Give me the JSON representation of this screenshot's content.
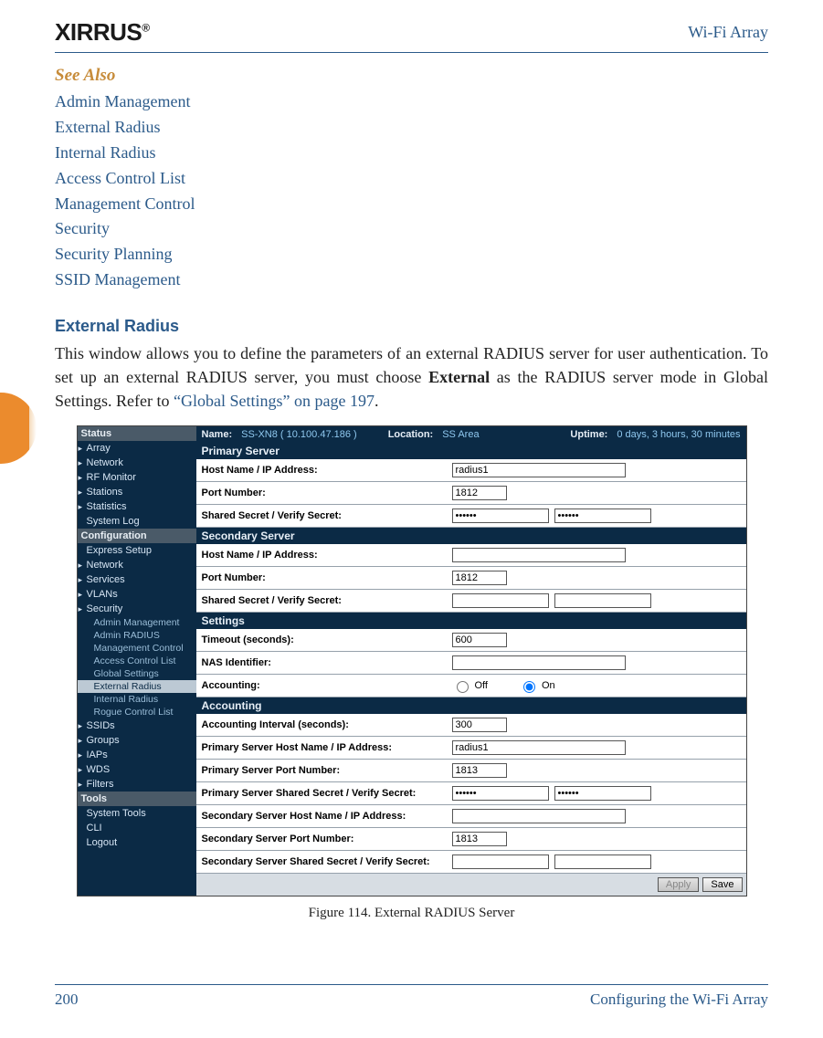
{
  "header": {
    "logo_text": "XIRRUS",
    "doc_type": "Wi-Fi Array"
  },
  "see_also": {
    "title": "See Also",
    "links": [
      "Admin Management",
      "External Radius",
      "Internal Radius",
      "Access Control List",
      "Management Control",
      "Security",
      "Security Planning",
      "SSID Management"
    ]
  },
  "section": {
    "title": "External Radius",
    "body_pre": "This window allows you to define the parameters of an external RADIUS server for user authentication. To set up an external RADIUS server, you must choose ",
    "body_bold": "External",
    "body_mid": " as the RADIUS server mode in Global Settings. Refer to ",
    "body_xref": "“Global Settings” on page 197",
    "body_end": "."
  },
  "screenshot": {
    "topbar": {
      "name_label": "Name:",
      "name_value": "SS-XN8   ( 10.100.47.186 )",
      "location_label": "Location:",
      "location_value": "SS Area",
      "uptime_label": "Uptime:",
      "uptime_value": "0 days, 3 hours, 30 minutes"
    },
    "nav": {
      "status_head": "Status",
      "status_items": [
        "Array",
        "Network",
        "RF Monitor",
        "Stations",
        "Statistics",
        "System Log"
      ],
      "config_head": "Configuration",
      "config_items": [
        "Express Setup",
        "Network",
        "Services",
        "VLANs"
      ],
      "security_label": "Security",
      "security_items": [
        "Admin Management",
        "Admin RADIUS",
        "Management Control",
        "Access Control List",
        "Global Settings",
        "External Radius",
        "Internal Radius",
        "Rogue Control List"
      ],
      "post_security": [
        "SSIDs",
        "Groups",
        "IAPs",
        "WDS",
        "Filters"
      ],
      "tools_head": "Tools",
      "tools_items": [
        "System Tools",
        "CLI",
        "Logout"
      ]
    },
    "sections": {
      "primary": "Primary Server",
      "secondary": "Secondary Server",
      "settings": "Settings",
      "accounting": "Accounting"
    },
    "labels": {
      "host": "Host Name / IP Address:",
      "port": "Port Number:",
      "secret": "Shared Secret / Verify Secret:",
      "timeout": "Timeout (seconds):",
      "nas": "NAS Identifier:",
      "acct": "Accounting:",
      "acct_interval": "Accounting Interval (seconds):",
      "p_host": "Primary Server Host Name / IP Address:",
      "p_port": "Primary Server Port Number:",
      "p_secret": "Primary Server Shared Secret / Verify Secret:",
      "s_host": "Secondary Server Host Name / IP Address:",
      "s_port": "Secondary Server Port Number:",
      "s_secret": "Secondary Server Shared Secret / Verify Secret:",
      "off": "Off",
      "on": "On"
    },
    "values": {
      "primary_host": "radius1",
      "primary_port": "1812",
      "primary_secret": "••••••",
      "primary_verify": "••••••",
      "secondary_host": "",
      "secondary_port": "1812",
      "secondary_secret": "",
      "secondary_verify": "",
      "timeout": "600",
      "nas": "",
      "acct_selected": "On",
      "acct_interval": "300",
      "p_host": "radius1",
      "p_port": "1813",
      "p_secret": "••••••",
      "p_verify": "••••••",
      "s_host": "",
      "s_port": "1813",
      "s_secret": "",
      "s_verify": ""
    },
    "buttons": {
      "apply": "Apply",
      "save": "Save"
    }
  },
  "caption": "Figure 114. External RADIUS Server",
  "footer": {
    "page": "200",
    "chapter": "Configuring the Wi-Fi Array"
  }
}
